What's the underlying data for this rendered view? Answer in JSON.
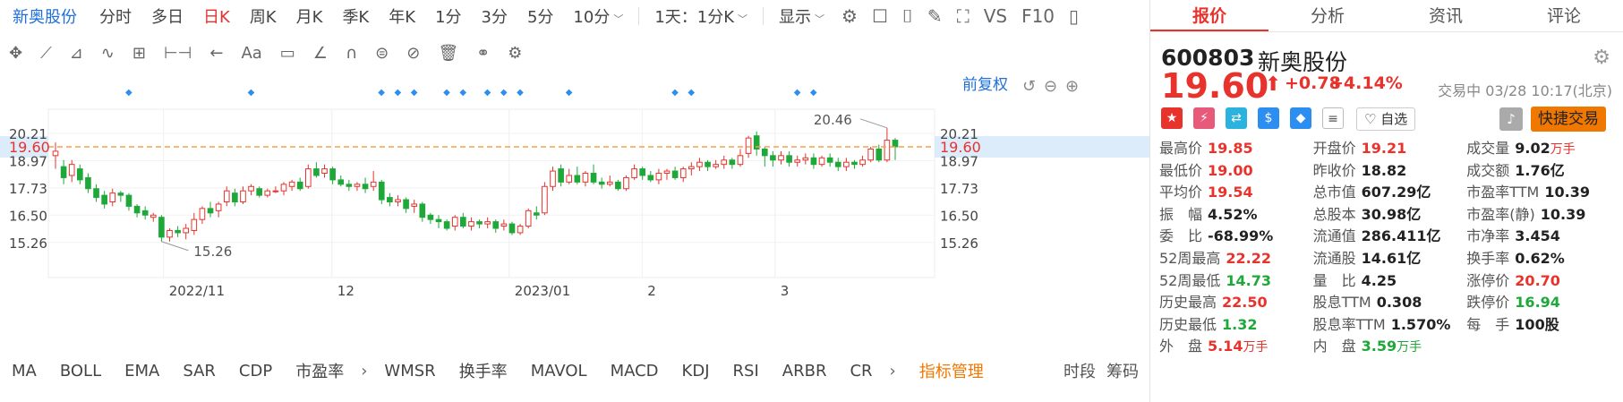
{
  "topbar": {
    "stock_name": "新奥股份",
    "periods": [
      "分时",
      "多日",
      "日K",
      "周K",
      "月K",
      "季K",
      "年K",
      "1分",
      "3分",
      "5分",
      "10分"
    ],
    "active_period": "日K",
    "range_select": "1天：1分K",
    "display_label": "显示",
    "vs_label": "VS",
    "f10_label": "F10"
  },
  "drawbar": {
    "text_tool": "Aa"
  },
  "chart": {
    "adjust_label": "前复权",
    "high_marker": "20.46",
    "low_marker": "15.26",
    "current_price_label": "19.60",
    "y_ticks": [
      "20.21",
      "18.97",
      "17.73",
      "16.50",
      "15.26"
    ],
    "x_labels": [
      "2022/11",
      "12",
      "2023/01",
      "2",
      "3"
    ],
    "colors": {
      "up": "#e8332d",
      "down": "#1fa83a",
      "marker": "#2b8ef0",
      "priceline": "#f5a04a"
    }
  },
  "chart_data": {
    "type": "candlestick",
    "ylim": [
      14.6,
      20.9
    ],
    "current_price": 19.6,
    "max_label": 20.46,
    "min_label": 15.26,
    "candles": [
      [
        19.2,
        19.4,
        19.8,
        18.6
      ],
      [
        18.7,
        18.2,
        19.0,
        17.9
      ],
      [
        18.3,
        18.8,
        19.0,
        18.0
      ],
      [
        18.6,
        18.1,
        18.8,
        17.9
      ],
      [
        18.2,
        17.7,
        18.4,
        17.5
      ],
      [
        17.7,
        17.3,
        17.9,
        17.1
      ],
      [
        17.4,
        17.0,
        17.6,
        16.8
      ],
      [
        17.1,
        17.5,
        17.7,
        16.9
      ],
      [
        17.5,
        17.4,
        17.6,
        17.1
      ],
      [
        17.4,
        16.9,
        17.5,
        16.7
      ],
      [
        16.9,
        16.6,
        17.0,
        16.4
      ],
      [
        16.7,
        16.5,
        16.9,
        16.3
      ],
      [
        16.4,
        16.5,
        16.6,
        16.2
      ],
      [
        16.4,
        15.5,
        16.5,
        15.3
      ],
      [
        15.5,
        15.8,
        15.9,
        15.3
      ],
      [
        15.8,
        15.7,
        16.0,
        15.5
      ],
      [
        15.7,
        15.9,
        16.1,
        15.4
      ],
      [
        15.8,
        16.3,
        16.6,
        15.6
      ],
      [
        16.3,
        16.8,
        16.9,
        16.1
      ],
      [
        16.8,
        16.6,
        17.1,
        16.4
      ],
      [
        16.7,
        17.0,
        17.1,
        16.4
      ],
      [
        17.1,
        17.6,
        17.8,
        16.9
      ],
      [
        17.5,
        17.1,
        17.7,
        16.9
      ],
      [
        17.1,
        17.6,
        17.8,
        17.0
      ],
      [
        17.6,
        17.8,
        17.9,
        17.4
      ],
      [
        17.7,
        17.4,
        17.8,
        17.3
      ],
      [
        17.4,
        17.6,
        17.7,
        17.3
      ],
      [
        17.6,
        17.6,
        17.8,
        17.5
      ],
      [
        17.6,
        17.9,
        18.0,
        17.4
      ],
      [
        17.8,
        18.0,
        18.1,
        17.6
      ],
      [
        18.0,
        17.7,
        18.2,
        17.6
      ],
      [
        17.8,
        18.6,
        18.8,
        17.7
      ],
      [
        18.6,
        18.3,
        18.9,
        18.2
      ],
      [
        18.4,
        18.6,
        18.8,
        18.2
      ],
      [
        18.6,
        18.1,
        18.7,
        17.9
      ],
      [
        18.1,
        17.9,
        18.3,
        17.8
      ],
      [
        17.9,
        17.8,
        18.1,
        17.6
      ],
      [
        17.8,
        17.9,
        18.0,
        17.6
      ],
      [
        17.9,
        17.7,
        18.2,
        17.5
      ],
      [
        17.8,
        18.0,
        18.5,
        17.6
      ],
      [
        18.0,
        17.2,
        18.1,
        17.0
      ],
      [
        17.3,
        17.1,
        17.5,
        16.9
      ],
      [
        17.1,
        17.2,
        17.4,
        16.9
      ],
      [
        17.2,
        16.8,
        17.3,
        16.6
      ],
      [
        16.9,
        17.0,
        17.2,
        16.6
      ],
      [
        17.0,
        16.4,
        17.1,
        16.2
      ],
      [
        16.5,
        16.3,
        16.6,
        16.1
      ],
      [
        16.3,
        16.2,
        16.5,
        15.9
      ],
      [
        16.2,
        15.9,
        16.3,
        15.8
      ],
      [
        16.0,
        16.4,
        16.5,
        15.8
      ],
      [
        16.4,
        16.0,
        16.6,
        15.9
      ],
      [
        16.0,
        16.2,
        16.4,
        15.8
      ],
      [
        16.2,
        16.1,
        16.3,
        15.9
      ],
      [
        16.1,
        16.2,
        16.4,
        15.9
      ],
      [
        16.2,
        15.9,
        16.3,
        15.7
      ],
      [
        16.0,
        16.1,
        16.3,
        15.8
      ],
      [
        16.1,
        15.7,
        16.2,
        15.6
      ],
      [
        15.7,
        16.0,
        16.1,
        15.6
      ],
      [
        16.0,
        16.7,
        16.8,
        15.9
      ],
      [
        16.6,
        16.5,
        16.9,
        16.3
      ],
      [
        16.6,
        17.8,
        18.0,
        16.5
      ],
      [
        17.8,
        18.5,
        18.7,
        17.6
      ],
      [
        18.6,
        18.0,
        18.8,
        17.8
      ],
      [
        18.0,
        18.3,
        18.6,
        17.9
      ],
      [
        18.3,
        18.0,
        18.7,
        17.9
      ],
      [
        18.0,
        18.4,
        18.5,
        17.8
      ],
      [
        18.4,
        18.0,
        18.8,
        17.9
      ],
      [
        18.0,
        17.9,
        18.2,
        17.7
      ],
      [
        17.9,
        18.0,
        18.3,
        17.8
      ],
      [
        18.0,
        17.7,
        18.1,
        17.6
      ],
      [
        17.7,
        18.2,
        18.3,
        17.6
      ],
      [
        18.2,
        18.6,
        18.8,
        18.1
      ],
      [
        18.6,
        18.3,
        18.7,
        18.1
      ],
      [
        18.3,
        18.1,
        18.5,
        18.0
      ],
      [
        18.1,
        18.4,
        18.6,
        17.9
      ],
      [
        18.4,
        18.5,
        18.6,
        18.1
      ],
      [
        18.5,
        18.2,
        18.7,
        18.1
      ],
      [
        18.2,
        18.6,
        18.7,
        18.0
      ],
      [
        18.6,
        18.7,
        18.9,
        18.3
      ],
      [
        18.7,
        18.9,
        19.1,
        18.5
      ],
      [
        18.9,
        18.7,
        19.0,
        18.5
      ],
      [
        18.7,
        18.8,
        19.0,
        18.6
      ],
      [
        18.8,
        19.0,
        19.2,
        18.6
      ],
      [
        19.0,
        18.8,
        19.1,
        18.6
      ],
      [
        18.8,
        19.2,
        19.5,
        18.7
      ],
      [
        19.3,
        20.0,
        20.1,
        19.1
      ],
      [
        20.1,
        19.5,
        20.3,
        19.2
      ],
      [
        19.5,
        19.2,
        19.6,
        18.7
      ],
      [
        19.2,
        19.0,
        19.4,
        18.7
      ],
      [
        19.0,
        19.2,
        19.4,
        18.8
      ],
      [
        19.2,
        18.9,
        19.4,
        18.7
      ],
      [
        18.9,
        19.0,
        19.2,
        18.7
      ],
      [
        19.0,
        19.1,
        19.3,
        18.8
      ],
      [
        19.1,
        18.8,
        19.3,
        18.6
      ],
      [
        18.8,
        19.1,
        19.2,
        18.7
      ],
      [
        19.1,
        18.9,
        19.3,
        18.7
      ],
      [
        18.9,
        18.7,
        19.1,
        18.5
      ],
      [
        18.7,
        18.9,
        19.1,
        18.5
      ],
      [
        18.9,
        18.8,
        19.0,
        18.6
      ],
      [
        18.8,
        19.0,
        19.2,
        18.7
      ],
      [
        19.0,
        19.5,
        19.6,
        18.9
      ],
      [
        19.5,
        19.0,
        19.7,
        18.9
      ],
      [
        19.0,
        19.9,
        20.46,
        18.9
      ],
      [
        19.9,
        19.6,
        20.0,
        19.0
      ]
    ],
    "event_marker_candles": [
      9,
      24,
      40,
      42,
      44,
      48,
      50,
      53,
      55,
      57,
      63,
      76,
      78,
      91,
      93,
      115,
      117,
      119
    ]
  },
  "bottomnav": {
    "indicators_left": [
      "MA",
      "BOLL",
      "EMA",
      "SAR",
      "CDP",
      "市盈率"
    ],
    "indicators_right": [
      "WMSR",
      "换手率",
      "MAVOL",
      "MACD",
      "KDJ",
      "RSI",
      "ARBR",
      "CR"
    ],
    "manage_label": "指标管理",
    "tail": [
      "时段",
      "筹码"
    ]
  },
  "panel": {
    "tabs": [
      "报价",
      "分析",
      "资讯",
      "评论"
    ],
    "active_tab": "报价",
    "code": "600803",
    "name": "新奥股份",
    "price": "19.60",
    "change": "+0.78",
    "change_pct": "+4.14%",
    "trade_time": "交易中 03/28 10:17(北京)",
    "fav_label": "自选",
    "quick_trade": "快捷交易",
    "rows": [
      [
        {
          "k": "最高价",
          "v": "19.85",
          "c": "red"
        },
        {
          "k": "开盘价",
          "v": "19.21",
          "c": "red"
        },
        {
          "k": "成交量",
          "v": "9.02",
          "u": "万手",
          "c": ""
        }
      ],
      [
        {
          "k": "最低价",
          "v": "19.00",
          "c": "red"
        },
        {
          "k": "昨收价",
          "v": "18.82",
          "c": ""
        },
        {
          "k": "成交额",
          "v": "1.76亿",
          "c": ""
        }
      ],
      [
        {
          "k": "平均价",
          "v": "19.54",
          "c": "red"
        },
        {
          "k": "总市值",
          "v": "607.29亿",
          "c": ""
        },
        {
          "k": "市盈率TTM",
          "v": "10.39",
          "c": ""
        }
      ],
      [
        {
          "k": "振　幅",
          "v": "4.52%",
          "c": ""
        },
        {
          "k": "总股本",
          "v": "30.98亿",
          "c": ""
        },
        {
          "k": "市盈率(静)",
          "v": "10.39",
          "c": ""
        }
      ],
      [
        {
          "k": "委　比",
          "v": "-68.99%",
          "c": ""
        },
        {
          "k": "流通值",
          "v": "286.411亿",
          "c": ""
        },
        {
          "k": "市净率",
          "v": "3.454",
          "c": ""
        }
      ],
      [
        {
          "k": "52周最高",
          "v": "22.22",
          "c": "red"
        },
        {
          "k": "流通股",
          "v": "14.61亿",
          "c": ""
        },
        {
          "k": "换手率",
          "v": "0.62%",
          "c": ""
        }
      ],
      [
        {
          "k": "52周最低",
          "v": "14.73",
          "c": "green"
        },
        {
          "k": "量　比",
          "v": "4.25",
          "c": ""
        },
        {
          "k": "涨停价",
          "v": "20.70",
          "c": "red"
        }
      ],
      [
        {
          "k": "历史最高",
          "v": "22.50",
          "c": "red"
        },
        {
          "k": "股息TTM",
          "v": "0.308",
          "c": ""
        },
        {
          "k": "跌停价",
          "v": "16.94",
          "c": "green"
        }
      ],
      [
        {
          "k": "历史最低",
          "v": "1.32",
          "c": "green"
        },
        {
          "k": "股息率TTM",
          "v": "1.570%",
          "c": ""
        },
        {
          "k": "每　手",
          "v": "100股",
          "c": ""
        }
      ],
      [
        {
          "k": "外　盘",
          "v": "5.14",
          "u": "万手",
          "c": "red"
        },
        {
          "k": "内　盘",
          "v": "3.59",
          "u": "万手",
          "c": "green"
        },
        {
          "k": "",
          "v": "",
          "c": ""
        }
      ]
    ]
  }
}
